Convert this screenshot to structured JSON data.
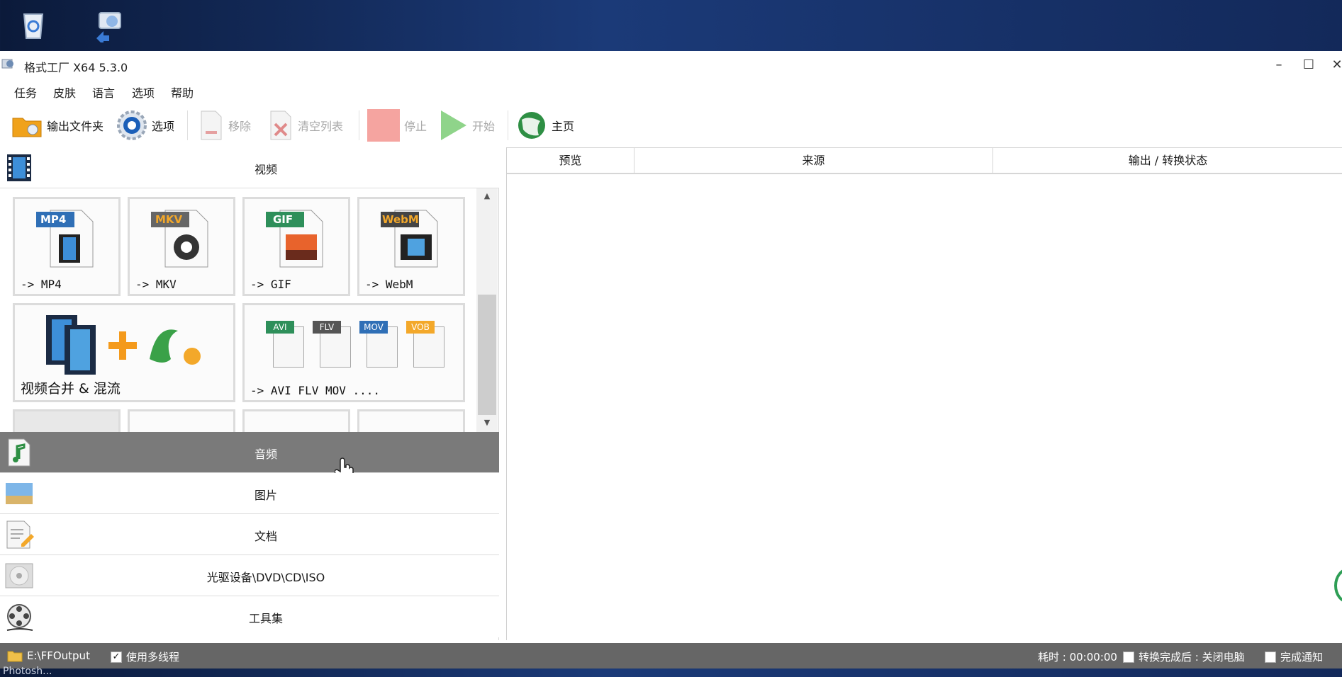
{
  "window": {
    "title": "格式工厂 X64 5.3.0",
    "controls": {
      "minimize": "–",
      "maximize": "☐",
      "close": "✕"
    }
  },
  "menu": [
    "任务",
    "皮肤",
    "语言",
    "选项",
    "帮助"
  ],
  "toolbar": {
    "output_folder": "输出文件夹",
    "options": "选项",
    "remove": "移除",
    "clear_list": "清空列表",
    "stop": "停止",
    "start": "开始",
    "home": "主页"
  },
  "categories": {
    "video": "视频",
    "audio": "音频",
    "image": "图片",
    "document": "文档",
    "disc": "光驱设备\\DVD\\CD\\ISO",
    "tools": "工具集"
  },
  "tiles": {
    "mp4": {
      "badge": "MP4",
      "label": "-> MP4"
    },
    "mkv": {
      "badge": "MKV",
      "label": "-> MKV"
    },
    "gif": {
      "badge": "GIF",
      "label": "-> GIF"
    },
    "webm": {
      "badge": "WebM",
      "label": "-> WebM"
    },
    "merge": {
      "label": "视频合并 & 混流"
    },
    "other": {
      "badges": [
        "AVI",
        "FLV",
        "MOV",
        "VOB"
      ],
      "label": "-> AVI FLV MOV ...."
    }
  },
  "list": {
    "columns": [
      "预览",
      "来源",
      "输出 / 转换状态"
    ]
  },
  "status": {
    "output_path": "E:\\FFOutput",
    "multithread": "使用多线程",
    "multithread_checked": true,
    "elapsed": "耗时 : 00:00:00",
    "after_convert": "转换完成后 : 关闭电脑",
    "notify": "完成通知"
  },
  "taskbar": {
    "text": "Photosh..."
  },
  "colors": {
    "active_category": "#7a7a7a",
    "statusbar": "#666666",
    "mp4_badge": "#2f6fb6",
    "mkv_badge": "#666666",
    "gif_badge": "#2e8f5a",
    "webm_badge": "#444444"
  }
}
